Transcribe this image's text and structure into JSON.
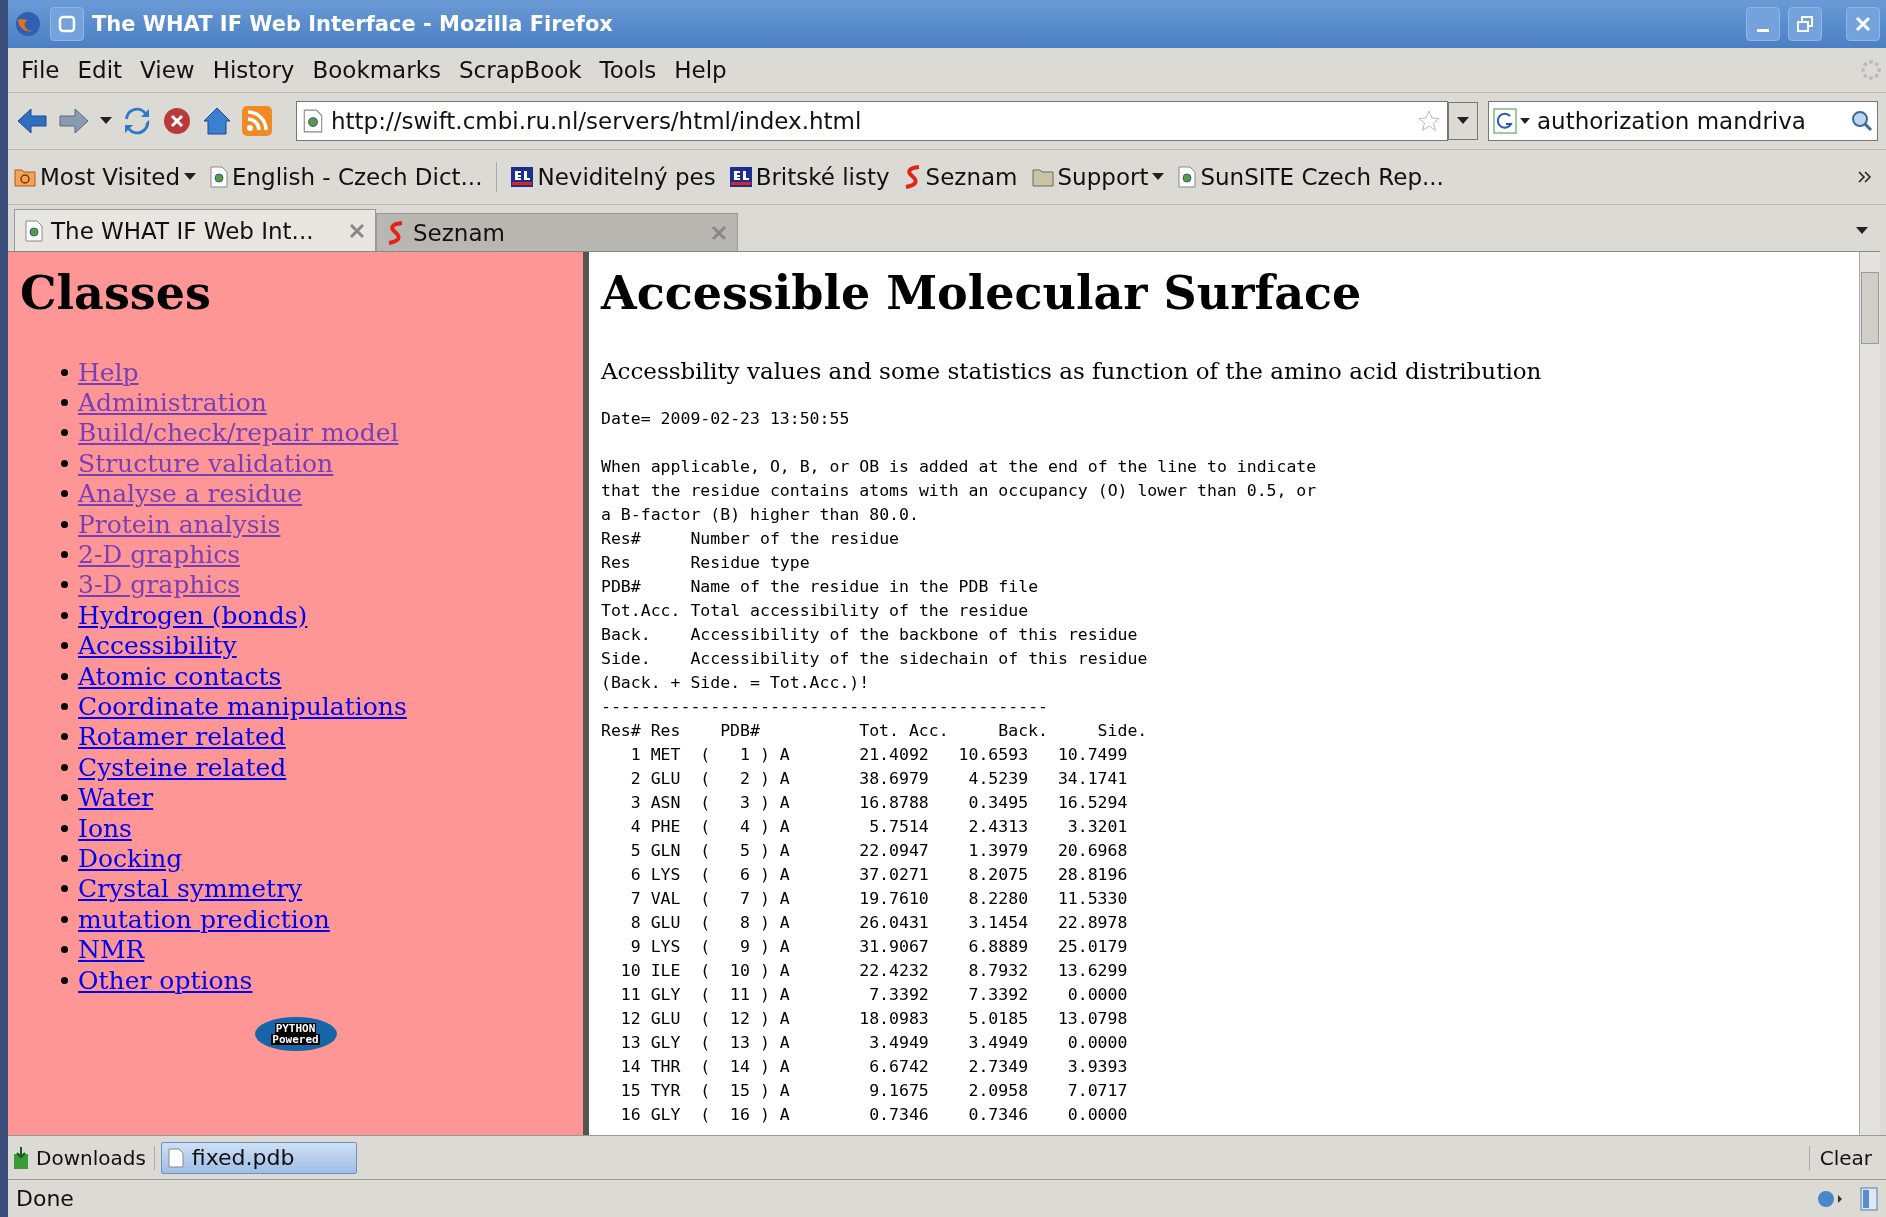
{
  "window": {
    "title": "The WHAT IF Web Interface - Mozilla Firefox"
  },
  "menu": [
    "File",
    "Edit",
    "View",
    "History",
    "Bookmarks",
    "ScrapBook",
    "Tools",
    "Help"
  ],
  "toolbar": {
    "address": "http://swift.cmbi.ru.nl/servers/html/index.html",
    "search": "authorization mandriva"
  },
  "bookmarks": [
    {
      "label": "Most Visited",
      "kind": "recent",
      "dropdown": true,
      "separator_after": false
    },
    {
      "label": "English - Czech Dict...",
      "kind": "page",
      "dropdown": false,
      "separator_after": true
    },
    {
      "label": "Neviditelný pes",
      "kind": "bl",
      "dropdown": false,
      "separator_after": false
    },
    {
      "label": "Britské listy",
      "kind": "bl",
      "dropdown": false,
      "separator_after": false
    },
    {
      "label": "Seznam",
      "kind": "seznam",
      "dropdown": false,
      "separator_after": false
    },
    {
      "label": "Support",
      "kind": "folder",
      "dropdown": true,
      "separator_after": false
    },
    {
      "label": "SunSITE Czech Rep...",
      "kind": "page",
      "dropdown": false,
      "separator_after": false
    }
  ],
  "tabs": [
    {
      "label": "The WHAT IF Web Int...",
      "kind": "page",
      "selected": true
    },
    {
      "label": "Seznam",
      "kind": "seznam",
      "selected": false
    }
  ],
  "sidebar": {
    "title": "Classes",
    "items": [
      {
        "label": "Help",
        "visited": true
      },
      {
        "label": "Administration",
        "visited": true
      },
      {
        "label": "Build/check/repair model",
        "visited": true
      },
      {
        "label": "Structure validation",
        "visited": true
      },
      {
        "label": "Analyse a residue",
        "visited": true
      },
      {
        "label": "Protein analysis",
        "visited": true
      },
      {
        "label": "2-D graphics",
        "visited": true
      },
      {
        "label": "3-D graphics",
        "visited": true
      },
      {
        "label": "Hydrogen (bonds)",
        "visited": false
      },
      {
        "label": "Accessibility",
        "visited": false
      },
      {
        "label": "Atomic contacts",
        "visited": false
      },
      {
        "label": "Coordinate manipulations",
        "visited": false
      },
      {
        "label": "Rotamer related",
        "visited": false
      },
      {
        "label": "Cysteine related",
        "visited": false
      },
      {
        "label": "Water",
        "visited": false
      },
      {
        "label": "Ions",
        "visited": false
      },
      {
        "label": "Docking",
        "visited": false
      },
      {
        "label": "Crystal symmetry",
        "visited": false
      },
      {
        "label": "mutation prediction",
        "visited": false
      },
      {
        "label": "NMR",
        "visited": false
      },
      {
        "label": "Other options",
        "visited": false
      }
    ],
    "logo": {
      "line_1": "PYTHON",
      "line_2": "Powered"
    }
  },
  "content": {
    "title": "Accessible Molecular Surface",
    "subtitle": "Accessbility values and some statistics as function of the amino acid distribution",
    "date": "Date= 2009-02-23 13:50:55",
    "note": "When applicable, O, B, or OB is added at the end of the line to indicate\nthat the residue contains atoms with an occupancy (O) lower than 0.5, or\na B-factor (B) higher than 80.0.",
    "legend": [
      "Res#     Number of the residue",
      "Res      Residue type",
      "PDB#     Name of the residue in the PDB file",
      "Tot.Acc. Total accessibility of the residue",
      "Back.    Accessibility of the backbone of this residue",
      "Side.    Accessibility of the sidechain of this residue",
      "(Back. + Side. = Tot.Acc.)!"
    ],
    "rule": "---------------------------------------------",
    "table": {
      "columns": [
        "Res#",
        "Res",
        "PDB#",
        "Tot. Acc.",
        "Back.",
        "Side."
      ],
      "rows": [
        [
          "1",
          "MET",
          "(   1 ) A",
          "21.4092",
          "10.6593",
          "10.7499"
        ],
        [
          "2",
          "GLU",
          "(   2 ) A",
          "38.6979",
          "4.5239",
          "34.1741"
        ],
        [
          "3",
          "ASN",
          "(   3 ) A",
          "16.8788",
          "0.3495",
          "16.5294"
        ],
        [
          "4",
          "PHE",
          "(   4 ) A",
          "5.7514",
          "2.4313",
          "3.3201"
        ],
        [
          "5",
          "GLN",
          "(   5 ) A",
          "22.0947",
          "1.3979",
          "20.6968"
        ],
        [
          "6",
          "LYS",
          "(   6 ) A",
          "37.0271",
          "8.2075",
          "28.8196"
        ],
        [
          "7",
          "VAL",
          "(   7 ) A",
          "19.7610",
          "8.2280",
          "11.5330"
        ],
        [
          "8",
          "GLU",
          "(   8 ) A",
          "26.0431",
          "3.1454",
          "22.8978"
        ],
        [
          "9",
          "LYS",
          "(   9 ) A",
          "31.9067",
          "6.8889",
          "25.0179"
        ],
        [
          "10",
          "ILE",
          "(  10 ) A",
          "22.4232",
          "8.7932",
          "13.6299"
        ],
        [
          "11",
          "GLY",
          "(  11 ) A",
          "7.3392",
          "7.3392",
          "0.0000"
        ],
        [
          "12",
          "GLU",
          "(  12 ) A",
          "18.0983",
          "5.0185",
          "13.0798"
        ],
        [
          "13",
          "GLY",
          "(  13 ) A",
          "3.4949",
          "3.4949",
          "0.0000"
        ],
        [
          "14",
          "THR",
          "(  14 ) A",
          "6.6742",
          "2.7349",
          "3.9393"
        ],
        [
          "15",
          "TYR",
          "(  15 ) A",
          "9.1675",
          "2.0958",
          "7.0717"
        ],
        [
          "16",
          "GLY",
          "(  16 ) A",
          "0.7346",
          "0.7346",
          "0.0000"
        ]
      ]
    }
  },
  "downloads": {
    "label": "Downloads",
    "file": "fixed.pdb",
    "clear": "Clear"
  },
  "status": "Done"
}
